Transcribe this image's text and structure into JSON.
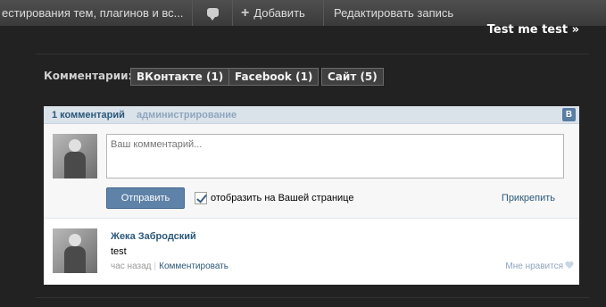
{
  "adminbar": {
    "site_title": "естирования тем, плагинов и вс...",
    "comments_icon": "comment-bubble-icon",
    "add_label": "Добавить",
    "add_icon": "plus-icon",
    "edit_label": "Редактировать запись"
  },
  "post": {
    "link": "Test me test »"
  },
  "comments": {
    "label": "Комментарии:",
    "tabs": [
      {
        "label": "ВКонтакте (1)"
      },
      {
        "label": "Facebook (1)"
      },
      {
        "label": "Сайт (5)"
      }
    ]
  },
  "widget": {
    "count": "1 комментарий",
    "admin": "администрирование",
    "logo": "В",
    "placeholder": "Ваш комментарий...",
    "submit": "Отправить",
    "show_on_page": "отобразить на Вашей странице",
    "attach": "Прикрепить",
    "comment": {
      "author": "Жека Забродский",
      "text": "test",
      "time": "час назад",
      "separator": "|",
      "reply": "Комментировать",
      "like": "Мне нравится"
    }
  }
}
